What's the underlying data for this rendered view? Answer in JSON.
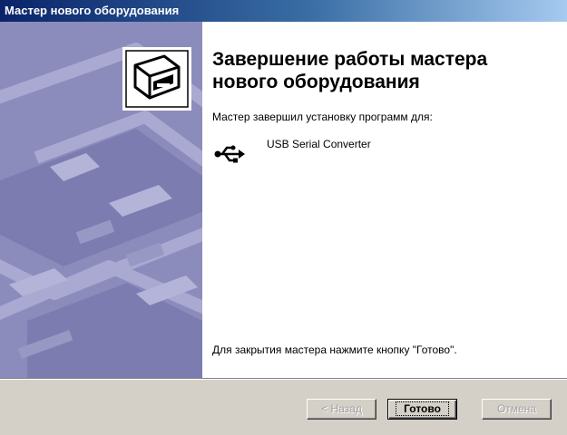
{
  "window": {
    "title": "Мастер нового оборудования"
  },
  "content": {
    "heading": "Завершение работы мастера нового оборудования",
    "subtitle": "Мастер завершил установку программ для:",
    "device_name": "USB Serial Converter",
    "finish_hint": "Для закрытия мастера нажмите кнопку \"Готово\"."
  },
  "buttons": {
    "back": {
      "label": "< Назад",
      "enabled": false
    },
    "finish": {
      "label": "Готово",
      "enabled": true,
      "default": true
    },
    "cancel": {
      "label": "Отмена",
      "enabled": false
    }
  },
  "icons": {
    "wizard_graphic": "hardware-wizard-icon",
    "device": "usb-icon"
  },
  "colors": {
    "title_bar_start": "#0a246a",
    "title_bar_end": "#a6caf0",
    "left_panel": "#8c8cbc",
    "button_face": "#d4d0c8"
  }
}
